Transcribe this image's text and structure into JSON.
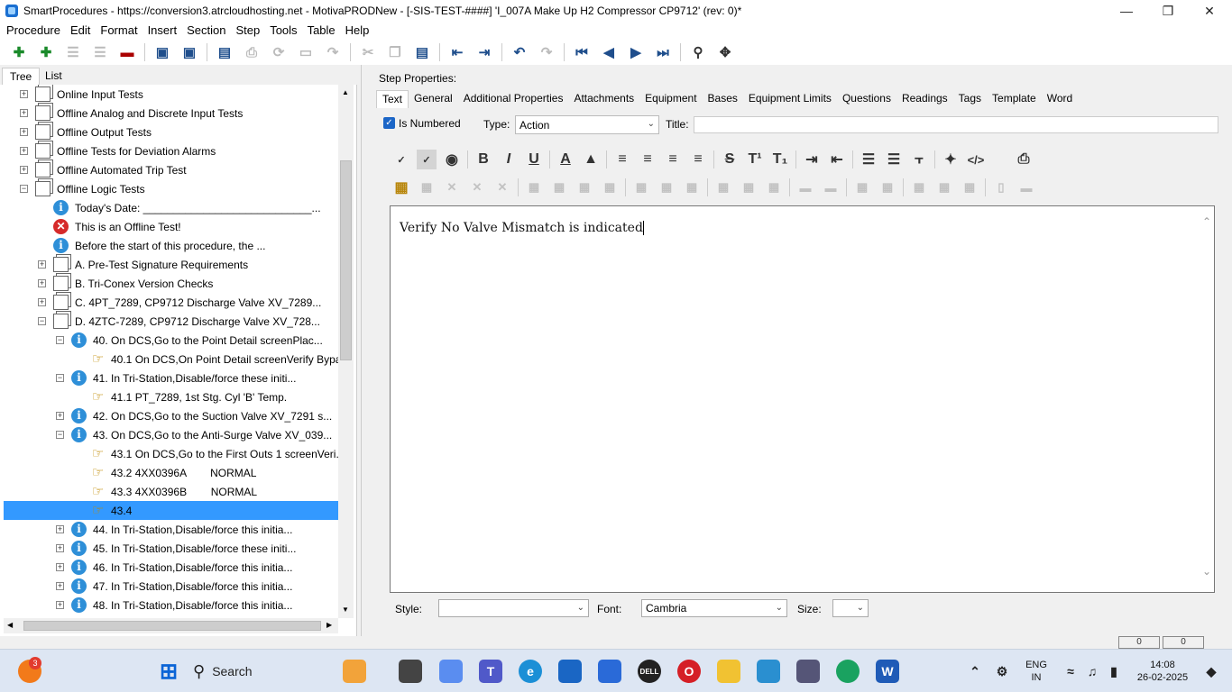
{
  "window": {
    "title": "SmartProcedures - https://conversion3.atrcloudhosting.net - MotivaPRODNew - [-SIS-TEST-####] 'I_007A Make Up H2 Compressor CP9712' (rev: 0)*"
  },
  "menu": [
    "Procedure",
    "Edit",
    "Format",
    "Insert",
    "Section",
    "Step",
    "Tools",
    "Table",
    "Help"
  ],
  "left_tabs": [
    "Tree",
    "List"
  ],
  "tree": [
    {
      "text": "Online Input Tests",
      "icon": "folder-icon",
      "exp": "+",
      "level": 0
    },
    {
      "text": "Offline Analog and Discrete Input Tests",
      "icon": "folder-icon",
      "exp": "+",
      "level": 0
    },
    {
      "text": "Offline Output Tests",
      "icon": "folder-icon",
      "exp": "+",
      "level": 0
    },
    {
      "text": "Offline Tests for Deviation Alarms",
      "icon": "folder-icon",
      "exp": "+",
      "level": 0
    },
    {
      "text": "Offline Automated Trip Test",
      "icon": "folder-icon",
      "exp": "+",
      "level": 0
    },
    {
      "text": "Offline Logic Tests",
      "icon": "folder-icon",
      "exp": "−",
      "level": 0
    },
    {
      "text": "Today's Date: ____________________________...",
      "icon": "info-icon",
      "exp": "",
      "level": 1
    },
    {
      "text": "This is an Offline Test!",
      "icon": "error-icon",
      "exp": "",
      "level": 1
    },
    {
      "text": "Before the start of this procedure, the ...",
      "icon": "info-icon",
      "exp": "",
      "level": 1
    },
    {
      "text": "A. Pre-Test Signature Requirements",
      "icon": "folder-icon",
      "exp": "+",
      "level": 1
    },
    {
      "text": "B. Tri-Conex Version Checks",
      "icon": "folder-icon",
      "exp": "+",
      "level": 1
    },
    {
      "text": "C. 4PT_7289, CP9712 Discharge Valve XV_7289...",
      "icon": "folder-icon",
      "exp": "+",
      "level": 1
    },
    {
      "text": "D. 4ZTC-7289, CP9712 Discharge Valve XV_728...",
      "icon": "folder-icon",
      "exp": "−",
      "level": 1
    },
    {
      "text": "40. On DCS,Go to the Point Detail screenPlac...",
      "icon": "info-icon",
      "exp": "−",
      "level": 2
    },
    {
      "text": "40.1 On DCS,On Point Detail screenVerify Bypa...",
      "icon": "hand-icon",
      "exp": "",
      "level": 3
    },
    {
      "text": "41. In Tri-Station,Disable/force these initi...",
      "icon": "info-icon",
      "exp": "−",
      "level": 2
    },
    {
      "text": "41.1 PT_7289, 1st Stg. Cyl 'B' Temp.",
      "icon": "hand-icon",
      "exp": "",
      "level": 3
    },
    {
      "text": "42. On DCS,Go to the Suction Valve XV_7291 s...",
      "icon": "info-icon",
      "exp": "+",
      "level": 2
    },
    {
      "text": "43. On DCS,Go to the Anti-Surge Valve XV_039...",
      "icon": "info-icon",
      "exp": "−",
      "level": 2
    },
    {
      "text": "43.1 On DCS,Go to the First Outs 1 screenVeri...",
      "icon": "hand-icon",
      "exp": "",
      "level": 3
    },
    {
      "text": "43.2 4XX0396A        NORMAL",
      "icon": "hand-icon",
      "exp": "",
      "level": 3
    },
    {
      "text": "43.3 4XX0396B        NORMAL",
      "icon": "hand-icon",
      "exp": "",
      "level": 3
    },
    {
      "text": "43.4",
      "icon": "hand-icon",
      "exp": "",
      "level": 3,
      "selected": true
    },
    {
      "text": "44. In Tri-Station,Disable/force this initia...",
      "icon": "info-icon",
      "exp": "+",
      "level": 2
    },
    {
      "text": "45. In Tri-Station,Disable/force these initi...",
      "icon": "info-icon",
      "exp": "+",
      "level": 2
    },
    {
      "text": "46. In Tri-Station,Disable/force this initia...",
      "icon": "info-icon",
      "exp": "+",
      "level": 2
    },
    {
      "text": "47. In Tri-Station,Disable/force this initia...",
      "icon": "info-icon",
      "exp": "+",
      "level": 2
    },
    {
      "text": "48. In Tri-Station,Disable/force this initia...",
      "icon": "info-icon",
      "exp": "+",
      "level": 2
    }
  ],
  "step_props": {
    "label": "Step Properties:",
    "tabs": [
      "Text",
      "General",
      "Additional Properties",
      "Attachments",
      "Equipment",
      "Bases",
      "Equipment Limits",
      "Questions",
      "Readings",
      "Tags",
      "Template",
      "Word"
    ],
    "is_numbered": "Is Numbered",
    "type_label": "Type:",
    "type_value": "Action",
    "title_label": "Title:",
    "title_value": "",
    "editor_text": "Verify No Valve Mismatch is indicated",
    "style_label": "Style:",
    "style_value": "",
    "font_label": "Font:",
    "font_value": "Cambria",
    "size_label": "Size:",
    "size_value": ""
  },
  "status": {
    "box1": "0",
    "box2": "0"
  },
  "taskbar": {
    "search": "Search",
    "notif_badge": "3",
    "lang1": "ENG",
    "lang2": "IN",
    "time": "14:08",
    "date": "26-02-2025"
  },
  "colors": {
    "selection": "#3399ff",
    "accent": "#1c66c7"
  }
}
